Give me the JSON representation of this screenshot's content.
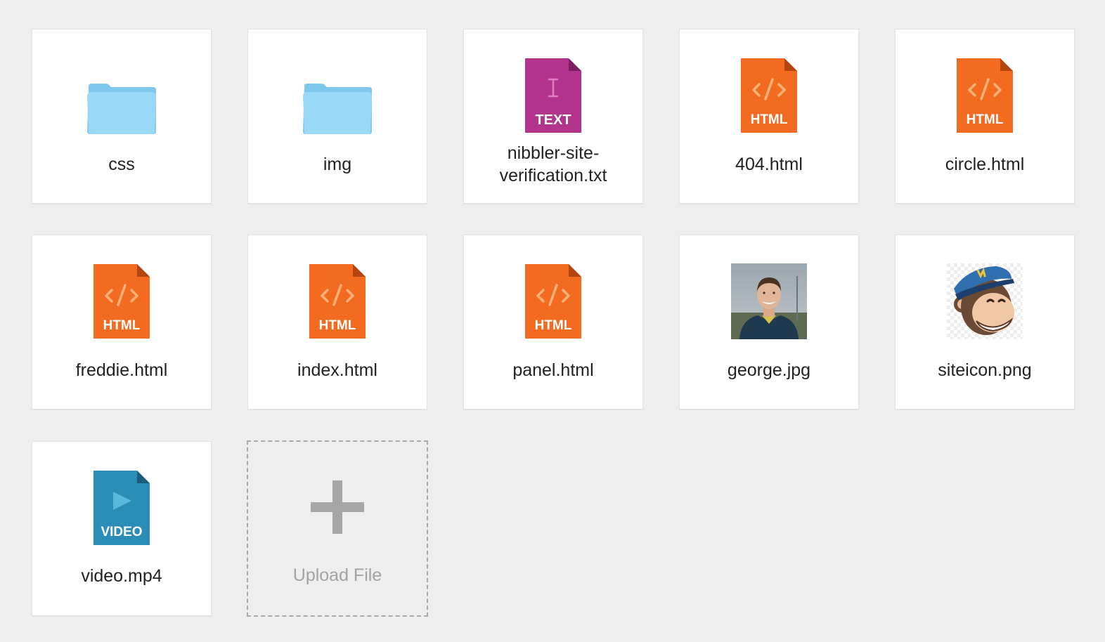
{
  "files": [
    {
      "name": "css",
      "type": "folder"
    },
    {
      "name": "img",
      "type": "folder"
    },
    {
      "name": "nibbler-site-\nverification.txt",
      "type": "text",
      "badge": "TEXT"
    },
    {
      "name": "404.html",
      "type": "html",
      "badge": "HTML"
    },
    {
      "name": "circle.html",
      "type": "html",
      "badge": "HTML"
    },
    {
      "name": "freddie.html",
      "type": "html",
      "badge": "HTML"
    },
    {
      "name": "index.html",
      "type": "html",
      "badge": "HTML"
    },
    {
      "name": "panel.html",
      "type": "html",
      "badge": "HTML"
    },
    {
      "name": "george.jpg",
      "type": "photo"
    },
    {
      "name": "siteicon.png",
      "type": "image"
    },
    {
      "name": "video.mp4",
      "type": "video",
      "badge": "VIDEO"
    }
  ],
  "upload": {
    "label": "Upload File"
  },
  "colors": {
    "page_background": "#eeeeee",
    "folder": "#94d4f6",
    "html_badge": "#f26b21",
    "text_badge": "#b3348c",
    "video_badge": "#2a8db6",
    "upload_border": "#a9a9a9"
  }
}
